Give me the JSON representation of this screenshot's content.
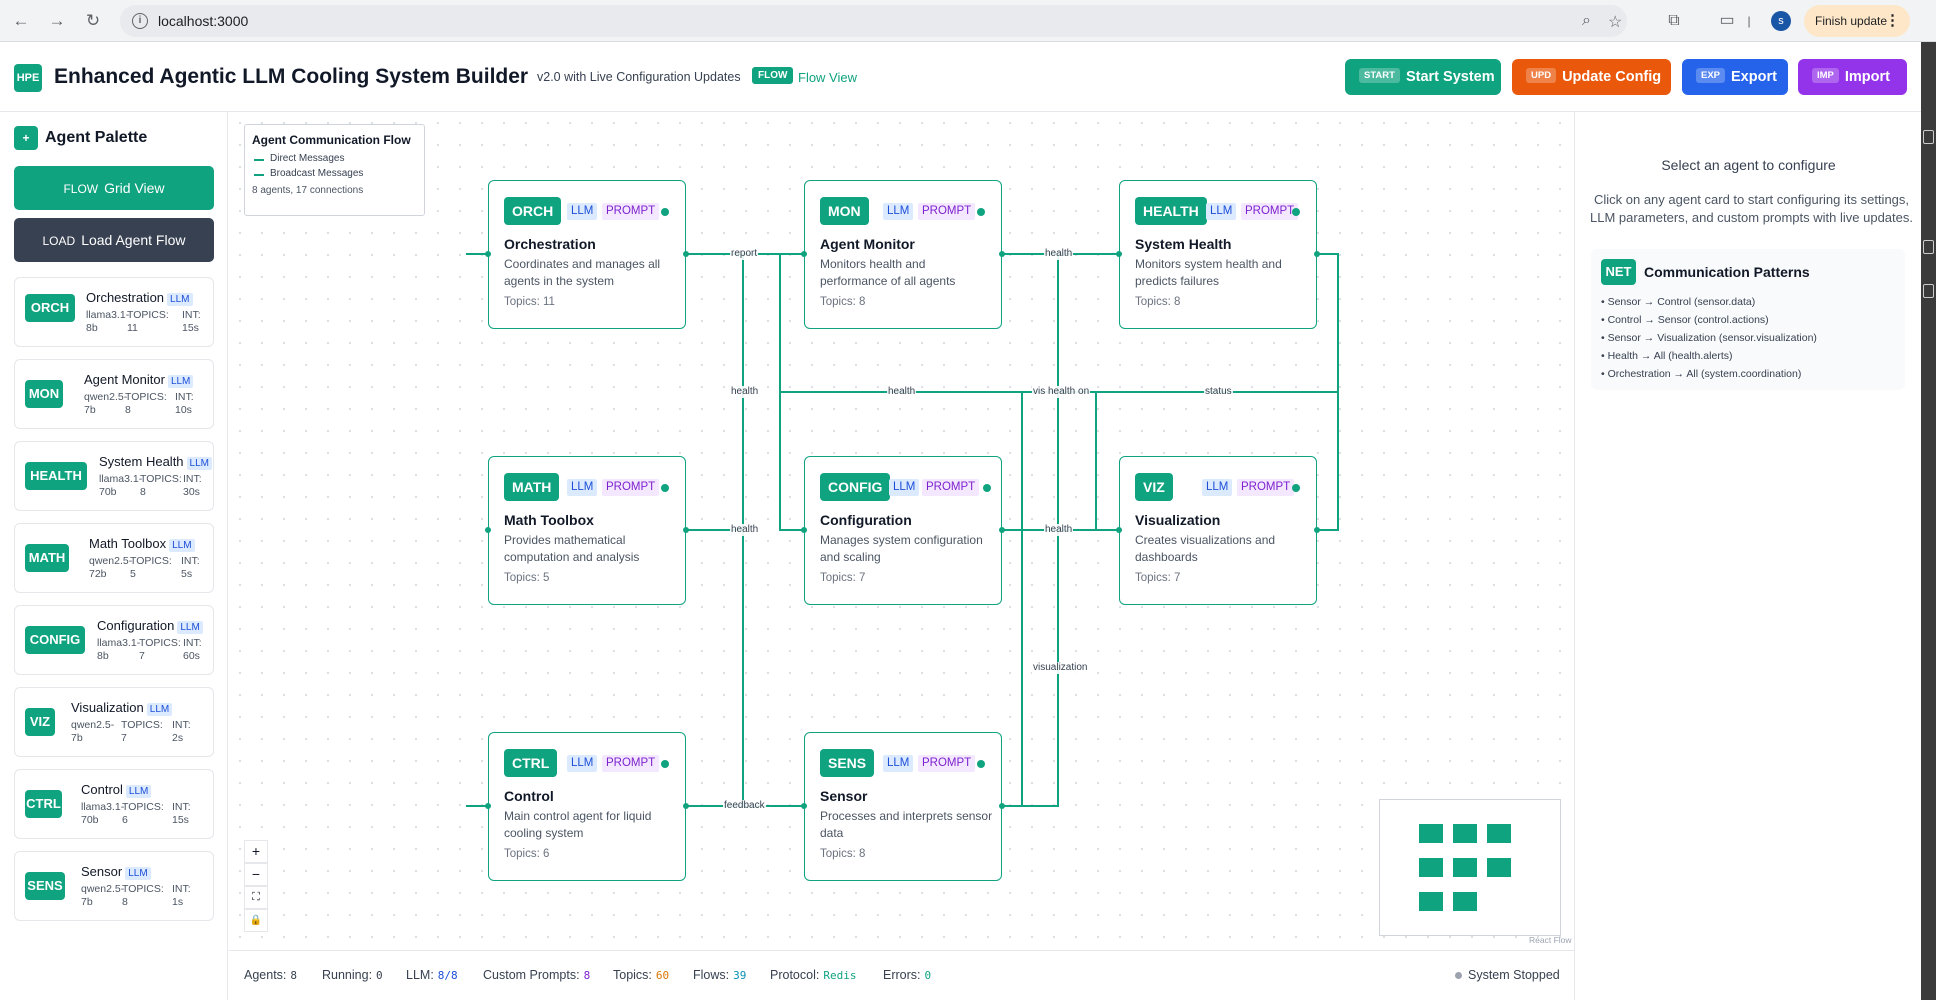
{
  "browser": {
    "url": "localhost:3000",
    "profile_initial": "s",
    "finish_update": "Finish update"
  },
  "header": {
    "logo": "HPE",
    "title": "Enhanced Agentic LLM Cooling System Builder",
    "version": "v2.0 with Live Configuration Updates",
    "flow_tag": "FLOW",
    "flow_view": "Flow View",
    "buttons": [
      {
        "tag": "START",
        "label": "Start System",
        "color": "#10a37f"
      },
      {
        "tag": "UPD",
        "label": "Update Config",
        "color": "#ea580c"
      },
      {
        "tag": "EXP",
        "label": "Export",
        "color": "#2563eb"
      },
      {
        "tag": "IMP",
        "label": "Import",
        "color": "#9333ea"
      }
    ]
  },
  "sidebar": {
    "icon": "+",
    "title": "Agent Palette",
    "grid_button": {
      "tag": "FLOW",
      "label": "Grid View"
    },
    "load_button": {
      "tag": "LOAD",
      "label": "Load Agent Flow"
    },
    "llm_tag": "LLM",
    "agents": [
      {
        "badge": "ORCH",
        "name": "Orchestration",
        "model": "llama3.1-8b",
        "topics": "TOPICS: 11",
        "interval": "INT: 15s"
      },
      {
        "badge": "MON",
        "name": "Agent Monitor",
        "model": "qwen2.5-7b",
        "topics": "TOPICS: 8",
        "interval": "INT: 10s"
      },
      {
        "badge": "HEALTH",
        "name": "System Health",
        "model": "llama3.1-70b",
        "topics": "TOPICS: 8",
        "interval": "INT: 30s"
      },
      {
        "badge": "MATH",
        "name": "Math Toolbox",
        "model": "qwen2.5-72b",
        "topics": "TOPICS: 5",
        "interval": "INT: 5s"
      },
      {
        "badge": "CONFIG",
        "name": "Configuration",
        "model": "llama3.1-8b",
        "topics": "TOPICS: 7",
        "interval": "INT: 60s"
      },
      {
        "badge": "VIZ",
        "name": "Visualization",
        "model": "qwen2.5-7b",
        "topics": "TOPICS: 7",
        "interval": "INT: 2s"
      },
      {
        "badge": "CTRL",
        "name": "Control",
        "model": "llama3.1-70b",
        "topics": "TOPICS: 6",
        "interval": "INT: 15s"
      },
      {
        "badge": "SENS",
        "name": "Sensor",
        "model": "qwen2.5-7b",
        "topics": "TOPICS: 8",
        "interval": "INT: 1s"
      }
    ]
  },
  "legend": {
    "title": "Agent Communication Flow",
    "direct": "Direct Messages",
    "broadcast": "Broadcast Messages",
    "count": "8 agents, 17 connections"
  },
  "nodes": [
    {
      "badge": "ORCH",
      "llm": "LLM",
      "prompt": "PROMPT",
      "name": "Orchestration",
      "desc": "Coordinates and manages all agents in the system",
      "topics": "Topics: 11"
    },
    {
      "badge": "MON",
      "llm": "LLM",
      "prompt": "PROMPT",
      "name": "Agent Monitor",
      "desc": "Monitors health and performance of all agents",
      "topics": "Topics: 8"
    },
    {
      "badge": "HEALTH",
      "llm": "LLM",
      "prompt": "PROMPT",
      "name": "System Health",
      "desc": "Monitors system health and predicts failures",
      "topics": "Topics: 8"
    },
    {
      "badge": "MATH",
      "llm": "LLM",
      "prompt": "PROMPT",
      "name": "Math Toolbox",
      "desc": "Provides mathematical computation and analysis",
      "topics": "Topics: 5"
    },
    {
      "badge": "CONFIG",
      "llm": "LLM",
      "prompt": "PROMPT",
      "name": "Configuration",
      "desc": "Manages system configuration and scaling",
      "topics": "Topics: 7"
    },
    {
      "badge": "VIZ",
      "llm": "LLM",
      "prompt": "PROMPT",
      "name": "Visualization",
      "desc": "Creates visualizations and dashboards",
      "topics": "Topics: 7"
    },
    {
      "badge": "CTRL",
      "llm": "LLM",
      "prompt": "PROMPT",
      "name": "Control",
      "desc": "Main control agent for liquid cooling system",
      "topics": "Topics: 6"
    },
    {
      "badge": "SENS",
      "llm": "LLM",
      "prompt": "PROMPT",
      "name": "Sensor",
      "desc": "Processes and interprets sensor data",
      "topics": "Topics: 8"
    }
  ],
  "edge_labels": [
    "report",
    "health",
    "health",
    "health",
    "vis health on",
    "status",
    "health",
    "health",
    "visualization",
    "feedback"
  ],
  "controls": {
    "zoom_in": "+",
    "zoom_out": "−",
    "fit": "⛶",
    "lock": "🔒"
  },
  "minimap_attribution": "React Flow",
  "right_panel": {
    "title": "Select an agent to configure",
    "desc": "Click on any agent card to start configuring its settings, LLM parameters, and custom prompts with live updates.",
    "patterns": {
      "icon": "NET",
      "title": "Communication Patterns",
      "items": [
        "• Sensor → Control (sensor.data)",
        "• Control → Sensor (control.actions)",
        "• Sensor → Visualization (sensor.visualization)",
        "• Health → All (health.alerts)",
        "• Orchestration → All (system.coordination)"
      ]
    }
  },
  "status": {
    "agents_label": "Agents:",
    "agents": "8",
    "running_label": "Running:",
    "running": "0",
    "llm_label": "LLM:",
    "llm": "8/8",
    "prompts_label": "Custom Prompts:",
    "prompts": "8",
    "topics_label": "Topics:",
    "topics": "60",
    "flows_label": "Flows:",
    "flows": "39",
    "protocol_label": "Protocol:",
    "protocol": "Redis",
    "errors_label": "Errors:",
    "errors": "0",
    "system": "System Stopped"
  }
}
